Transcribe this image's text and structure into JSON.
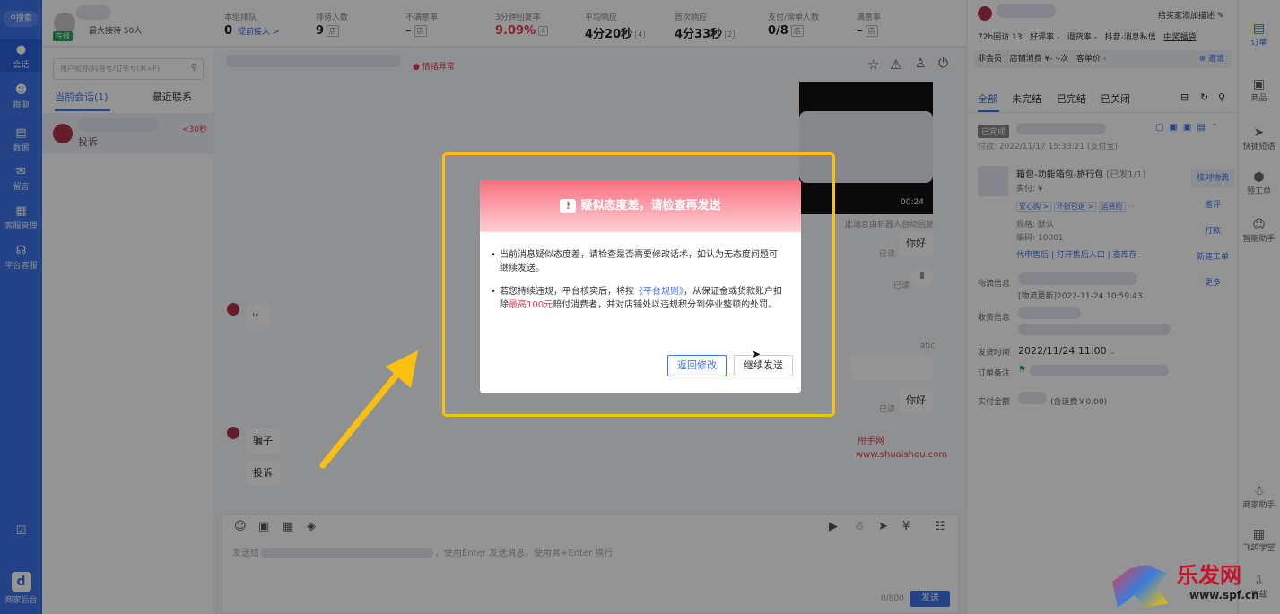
{
  "nav": {
    "search": "搜索",
    "items": [
      "会话",
      "群聊",
      "数据",
      "留言",
      "客服管理",
      "平台客服"
    ],
    "bottom": "商家后台"
  },
  "agent": {
    "status": "在线",
    "max_label": "最大接待 50人"
  },
  "stats": [
    {
      "label": "本组排队",
      "value": "0",
      "extra": "提前接入 >"
    },
    {
      "label": "排待人数",
      "value": "9",
      "extra": "店"
    },
    {
      "label": "不满意率",
      "value": "–",
      "extra": "店"
    },
    {
      "label": "3分钟回复率",
      "value": "9.09%",
      "extra": "4"
    },
    {
      "label": "平均响应",
      "value": "4分20秒",
      "extra": "4"
    },
    {
      "label": "首次响应",
      "value": "4分33秒",
      "extra": "2"
    },
    {
      "label": "支付/询单人数",
      "value": "0/8",
      "extra": "店"
    },
    {
      "label": "满意率",
      "value": "–",
      "extra": "店"
    }
  ],
  "convlist": {
    "search_placeholder": "用户昵称/抖音号/订单号(⌘+F)",
    "tab_current": "当前会话(1)",
    "tab_recent": "最近联系",
    "item": {
      "preview": "投诉",
      "timer": "<30秒"
    }
  },
  "chat": {
    "emotion_badge": "情绪异常",
    "video_time": "00:24",
    "robot_note": "此消息由机器人自动回复",
    "read": "已读",
    "nihao": "你好",
    "abc": "abc",
    "customer_msgs": [
      "骗子",
      "投诉"
    ],
    "watermark1": "甩手网",
    "watermark2": "www.shuaishou.com",
    "input_placeholder": "，使用Enter 发送消息，使用⌘+Enter 换行",
    "send_prefix": "发送给",
    "counter": "0/800",
    "send": "发送"
  },
  "dialog": {
    "title": "疑似态度差，请检查再发送",
    "para1": "当前消息疑似态度差，请检查是否需要修改话术，如认为无态度问题可继续发送。",
    "para2_a": "若您持续违规，平台核实后，将按",
    "para2_link": "《平台规则》",
    "para2_b": "，从保证金或货款账户扣除",
    "para2_red": "最高100元",
    "para2_c": "赔付消费者，并对店铺处以违规积分到停业整顿的处罚。",
    "btn_back": "返回修改",
    "btn_continue": "继续发送"
  },
  "right": {
    "add_desc": "给买家添加描述",
    "row2": [
      "72h回访 13",
      "好评率 -",
      "退货率 -",
      "抖音-消息私信",
      "中奖福袋"
    ],
    "row3": [
      "非会员",
      "店铺消费 ¥- ·-次",
      "客单价 -",
      "邀请"
    ],
    "tabs": [
      "全部",
      "未完结",
      "已完结",
      "已关闭"
    ],
    "order_status": "已完成",
    "order_time": "付款: 2022/11/17 15:33:21 (支付宝)",
    "product": {
      "name": "箱包-功能箱包-旅行包",
      "ship": "[已发1/1]",
      "paid": "实付: ¥",
      "tags": [
        "安心购 >",
        "坏损包退 >",
        "运费险",
        "···"
      ],
      "spec": "规格: 默认",
      "code": "编码: 10001"
    },
    "links": [
      "代申售后",
      "打开售后入口",
      "查库存"
    ],
    "actions": [
      "核对物流",
      "邀评",
      "打款",
      "新建工单",
      "更多"
    ],
    "logistics_label": "物流信息",
    "logistics_update": "[物流更新]2022-11-24 10:59:43",
    "address_label": "收货信息",
    "ship_time_label": "发货时间",
    "ship_time": "2022/11/24 11:00",
    "remark_label": "订单备注",
    "paid_label": "实付金额",
    "paid_value": "(含运费￥0.00)"
  },
  "rightbar": [
    "订单",
    "商品",
    "快捷短语",
    "预工单",
    "智能助手",
    "商家助手",
    "飞鸽学堂",
    "下载"
  ],
  "brand": {
    "name": "乐发网",
    "url": "www.spf.cn"
  },
  "colors": {
    "primary": "#3f74e8",
    "danger": "#e23d4f",
    "highlight": "#fbbf10"
  }
}
